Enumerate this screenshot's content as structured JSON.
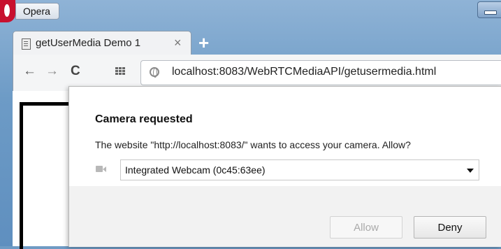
{
  "window": {
    "menu_label": "Opera"
  },
  "tab": {
    "title": "getUserMedia Demo 1",
    "close_glyph": "×",
    "new_tab_glyph": "+"
  },
  "toolbar": {
    "back_glyph": "←",
    "forward_glyph": "→",
    "reload_glyph": "C",
    "url": "localhost:8083/WebRTCMediaAPI/getusermedia.html"
  },
  "permission_dialog": {
    "title": "Camera requested",
    "message": "The website \"http://localhost:8083/\" wants to access your camera. Allow?",
    "device_select": {
      "selected": "Integrated Webcam (0c45:63ee)"
    },
    "allow_label": "Allow",
    "deny_label": "Deny"
  },
  "colors": {
    "opera_red": "#c8102e",
    "frame_blue": "#6d9bc6"
  }
}
